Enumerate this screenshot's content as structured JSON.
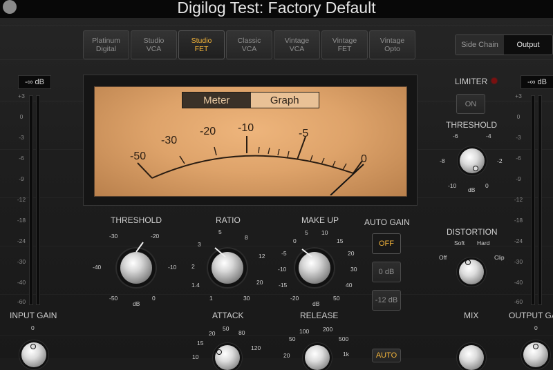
{
  "window": {
    "title": "Digilog Test: Factory Default"
  },
  "models": [
    {
      "label": "Platinum\nDigital",
      "active": false
    },
    {
      "label": "Studio\nVCA",
      "active": false
    },
    {
      "label": "Studio\nFET",
      "active": true
    },
    {
      "label": "Classic\nVCA",
      "active": false
    },
    {
      "label": "Vintage\nVCA",
      "active": false
    },
    {
      "label": "Vintage\nFET",
      "active": false
    },
    {
      "label": "Vintage\nOpto",
      "active": false
    }
  ],
  "sidechain_output": {
    "side_chain": "Side Chain",
    "output": "Output",
    "selected": "Output"
  },
  "meter": {
    "meter_label": "Meter",
    "graph_label": "Graph",
    "selected": "Meter",
    "scale": [
      "-50",
      "-30",
      "-20",
      "-10",
      "-5",
      "0"
    ]
  },
  "input": {
    "readout": "-∞ dB",
    "label": "INPUT GAIN",
    "scale": [
      "+3",
      "0",
      "-3",
      "-6",
      "-9",
      "-12",
      "-18",
      "-24",
      "-30",
      "-40",
      "-60"
    ],
    "knob_scale": [
      "0"
    ]
  },
  "output": {
    "readout": "-∞ dB",
    "label": "OUTPUT GA",
    "scale": [
      "+3",
      "0",
      "-3",
      "-6",
      "-9",
      "-12",
      "-18",
      "-24",
      "-30",
      "-40",
      "-60"
    ],
    "knob_scale": [
      "0"
    ]
  },
  "threshold": {
    "label": "THRESHOLD",
    "scale": [
      "-30",
      "-20",
      "-40",
      "-10",
      "-50",
      "0"
    ],
    "unit": "dB"
  },
  "ratio": {
    "label": "RATIO",
    "scale": [
      "5",
      "3",
      "8",
      "2",
      "12",
      "1.4",
      "20",
      "1",
      "30"
    ]
  },
  "makeup": {
    "label": "MAKE UP",
    "scale": [
      "0",
      "5",
      "10",
      "15",
      "-5",
      "20",
      "-10",
      "30",
      "-15",
      "40",
      "-20",
      "50"
    ],
    "unit": "dB"
  },
  "auto_gain": {
    "label": "AUTO GAIN",
    "options": [
      "OFF",
      "0 dB",
      "-12 dB"
    ],
    "selected": "OFF"
  },
  "attack": {
    "label": "ATTACK",
    "scale": [
      "20",
      "50",
      "80",
      "15",
      "120",
      "10"
    ]
  },
  "release": {
    "label": "RELEASE",
    "scale": [
      "100",
      "200",
      "50",
      "500",
      "20",
      "1k"
    ]
  },
  "limiter": {
    "label": "LIMITER",
    "button": "ON"
  },
  "limiter_threshold": {
    "label": "THRESHOLD",
    "scale": [
      "-6",
      "-4",
      "-8",
      "-2",
      "-10",
      "0"
    ],
    "unit": "dB"
  },
  "distortion": {
    "label": "DISTORTION",
    "scale": [
      "Soft",
      "Hard",
      "Off",
      "Clip"
    ]
  },
  "mix": {
    "label": "MIX"
  },
  "auto_release_label": "AUTO"
}
